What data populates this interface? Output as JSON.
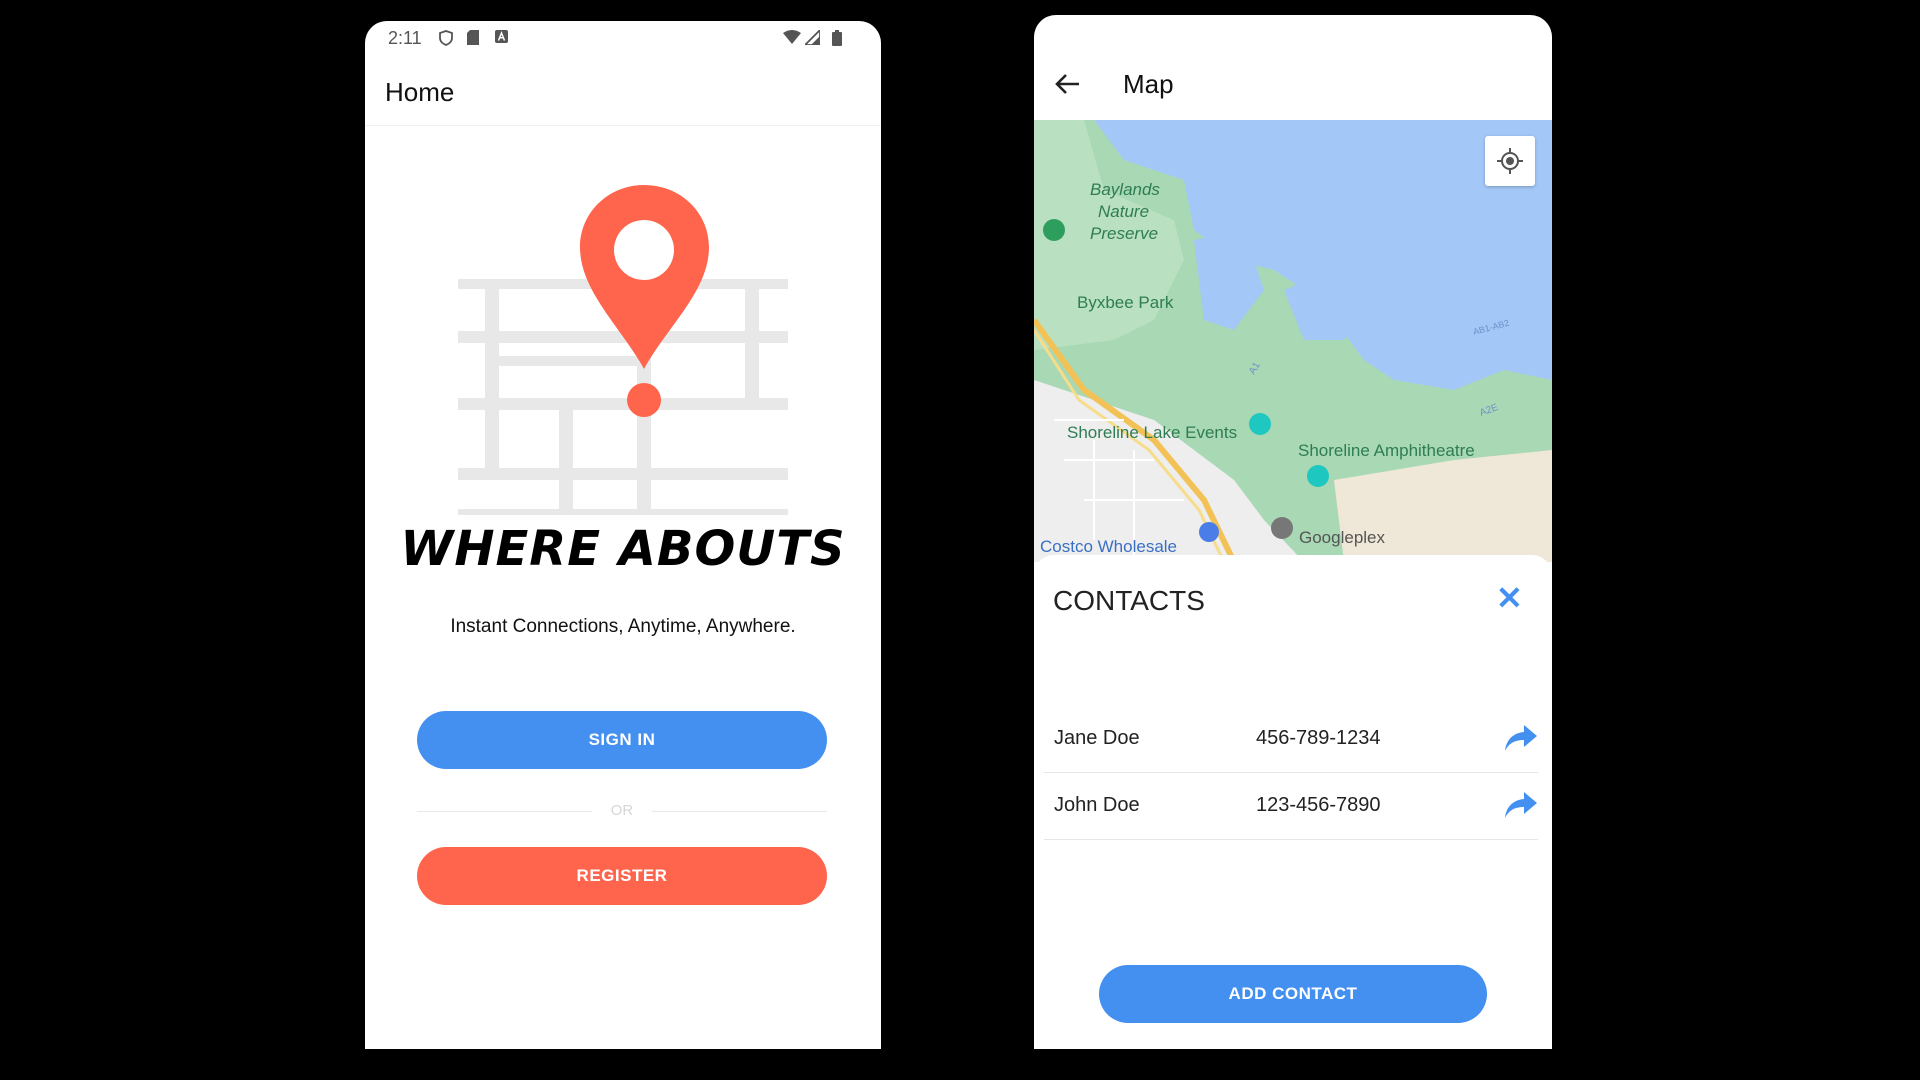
{
  "left_screen": {
    "status": {
      "time": "2:11"
    },
    "appbar": {
      "title": "Home"
    },
    "brand": "WHERE ABOUTS",
    "tagline": "Instant Connections, Anytime, Anywhere.",
    "sign_in_label": "SIGN IN",
    "or_label": "OR",
    "register_label": "REGISTER"
  },
  "right_screen": {
    "appbar": {
      "title": "Map"
    },
    "map": {
      "labels": [
        "Baylands Nature Preserve",
        "Byxbee Park",
        "Shoreline Lake Events",
        "Shoreline Amphitheatre",
        "Costco Wholesale",
        "Googleplex"
      ],
      "road_labels": [
        "A1",
        "A2E",
        "AB1-AB2"
      ]
    },
    "sheet": {
      "title": "CONTACTS",
      "contacts": [
        {
          "name": "Jane Doe",
          "phone": "456-789-1234"
        },
        {
          "name": "John Doe",
          "phone": "123-456-7890"
        }
      ],
      "add_label": "ADD CONTACT"
    }
  },
  "colors": {
    "primary_blue": "#4490f0",
    "accent_orange": "#fe654c",
    "water": "#a3c7f7",
    "park": "#a8d8b4"
  },
  "icons": [
    "shield-icon",
    "sd-card-icon",
    "a-icon",
    "wifi-icon",
    "signal-icon",
    "battery-icon",
    "map-pin-icon",
    "back-arrow-icon",
    "my-location-icon",
    "close-icon",
    "share-arrow-icon"
  ]
}
